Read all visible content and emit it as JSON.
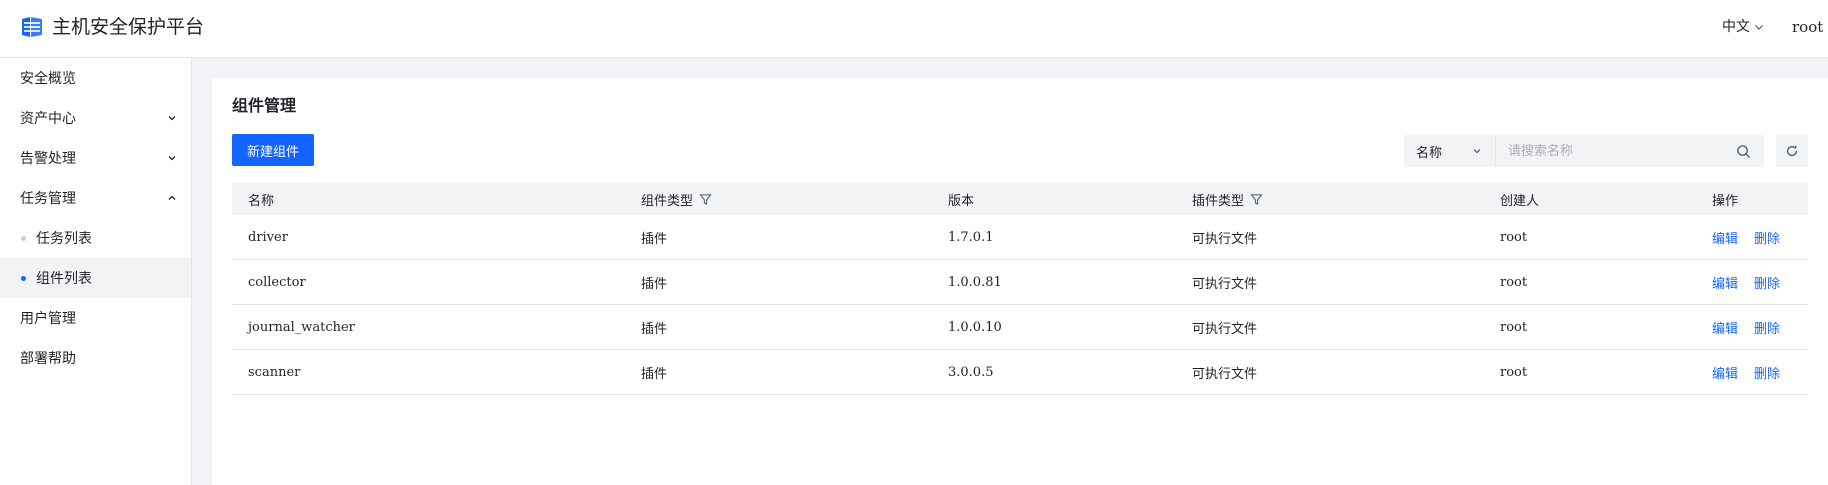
{
  "header": {
    "brand": "主机安全保护平台",
    "language": "中文",
    "user": "root"
  },
  "sidebar": {
    "items": [
      {
        "label": "安全概览"
      },
      {
        "label": "资产中心",
        "expandable": true,
        "expanded": false
      },
      {
        "label": "告警处理",
        "expandable": true,
        "expanded": false
      },
      {
        "label": "任务管理",
        "expandable": true,
        "expanded": true
      },
      {
        "label": "任务列表",
        "sub": true,
        "active": false
      },
      {
        "label": "组件列表",
        "sub": true,
        "active": true
      },
      {
        "label": "用户管理"
      },
      {
        "label": "部署帮助"
      }
    ]
  },
  "main": {
    "title": "组件管理",
    "new_button": "新建组件",
    "search": {
      "field": "名称",
      "placeholder": "请搜索名称"
    },
    "table": {
      "columns": [
        "名称",
        "组件类型",
        "版本",
        "插件类型",
        "创建人",
        "操作"
      ],
      "rows": [
        {
          "name": "driver",
          "type": "插件",
          "version": "1.7.0.1",
          "plugin_type": "可执行文件",
          "creator": "root"
        },
        {
          "name": "collector",
          "type": "插件",
          "version": "1.0.0.81",
          "plugin_type": "可执行文件",
          "creator": "root"
        },
        {
          "name": "journal_watcher",
          "type": "插件",
          "version": "1.0.0.10",
          "plugin_type": "可执行文件",
          "creator": "root"
        },
        {
          "name": "scanner",
          "type": "插件",
          "version": "3.0.0.5",
          "plugin_type": "可执行文件",
          "creator": "root"
        }
      ],
      "actions": {
        "edit": "编辑",
        "delete": "删除"
      }
    }
  },
  "colors": {
    "accent": "#1664ff",
    "background": "#f2f3f7",
    "text": "#1f2329"
  }
}
